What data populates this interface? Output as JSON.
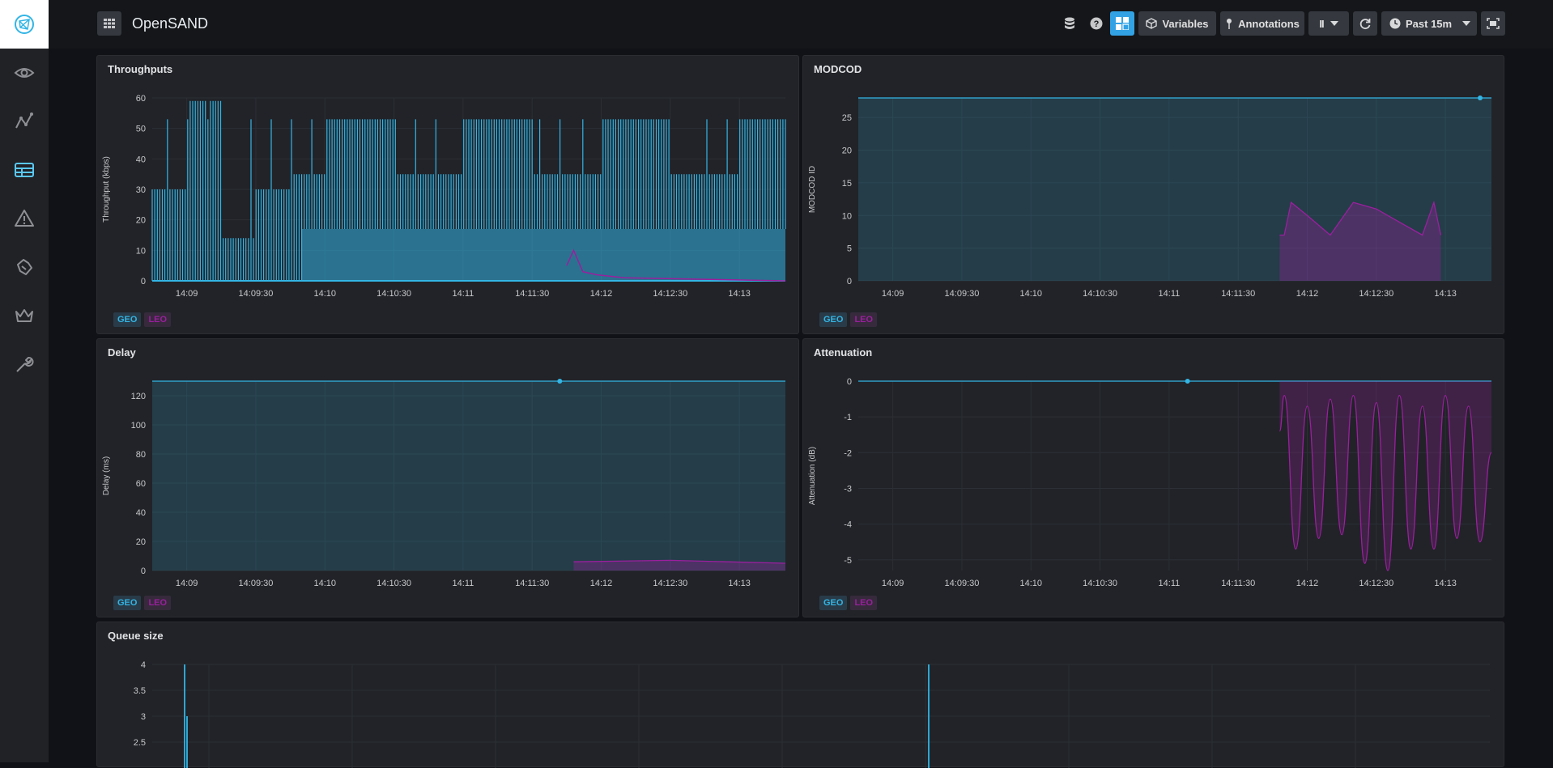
{
  "app": {
    "title": "OpenSAND"
  },
  "toolbar": {
    "variables_label": "Variables",
    "annotations_label": "Annotations",
    "pause_label": "II",
    "time_range_label": "Past 15m",
    "icons": [
      "database-icon",
      "help-icon",
      "dashboard-add-icon",
      "cube-icon",
      "pin-icon",
      "pause-icon",
      "refresh-icon",
      "clock-icon",
      "kiosk-icon"
    ]
  },
  "sidebar": {
    "items": [
      {
        "icon": "eye-icon",
        "active": false
      },
      {
        "icon": "explore-icon",
        "active": false
      },
      {
        "icon": "dashboards-icon",
        "active": true
      },
      {
        "icon": "alert-icon",
        "active": false
      },
      {
        "icon": "plugins-icon",
        "active": false
      },
      {
        "icon": "crown-icon",
        "active": false
      },
      {
        "icon": "wrench-icon",
        "active": false
      }
    ]
  },
  "colors": {
    "geo": "#33b5e5",
    "leo": "#9b1f9e",
    "background": "#111217",
    "panel": "#212328"
  },
  "panels": [
    {
      "title": "Throughputs",
      "legend": [
        "GEO",
        "LEO"
      ]
    },
    {
      "title": "MODCOD",
      "legend": [
        "GEO",
        "LEO"
      ]
    },
    {
      "title": "Delay",
      "legend": [
        "GEO",
        "LEO"
      ]
    },
    {
      "title": "Attenuation",
      "legend": [
        "GEO",
        "LEO"
      ]
    },
    {
      "title": "Queue size"
    }
  ],
  "chart_data": [
    {
      "type": "line",
      "title": "Throughputs",
      "ylabel": "Throughput (kbps)",
      "ylim": [
        0,
        60
      ],
      "yticks": [
        "60",
        "50",
        "40",
        "30",
        "20",
        "10",
        "0"
      ],
      "xticks": [
        "14:09",
        "14:09:30",
        "14:10",
        "14:10:30",
        "14:11",
        "14:11:30",
        "14:12",
        "14:12:30",
        "14:13"
      ],
      "series": [
        {
          "name": "GEO",
          "x": [
            "14:08:45",
            "14:09:00",
            "14:09:15",
            "14:09:30",
            "14:09:45",
            "14:10:00",
            "14:10:30",
            "14:11:00",
            "14:11:30",
            "14:12:00",
            "14:12:30",
            "14:13:00",
            "14:13:20"
          ],
          "y": [
            30,
            59,
            14,
            30,
            35,
            53,
            35,
            53,
            35,
            53,
            35,
            53,
            35
          ]
        },
        {
          "name": "LEO",
          "x": [
            "14:11:45",
            "14:11:48",
            "14:11:52",
            "14:11:58",
            "14:12:10",
            "14:13:20"
          ],
          "y": [
            5,
            10,
            3,
            2,
            1,
            0
          ]
        }
      ]
    },
    {
      "type": "area",
      "title": "MODCOD",
      "ylabel": "MODCOD ID",
      "ylim": [
        0,
        28
      ],
      "yticks": [
        "25",
        "20",
        "15",
        "10",
        "5",
        "0"
      ],
      "xticks": [
        "14:09",
        "14:09:30",
        "14:10",
        "14:10:30",
        "14:11",
        "14:11:30",
        "14:12",
        "14:12:30",
        "14:13"
      ],
      "series": [
        {
          "name": "GEO",
          "x": [
            "14:08:45",
            "14:13:20"
          ],
          "y": [
            28,
            28
          ]
        },
        {
          "name": "LEO",
          "x": [
            "14:11:48",
            "14:11:50",
            "14:11:53",
            "14:12:00",
            "14:12:10",
            "14:12:20",
            "14:12:30",
            "14:12:40",
            "14:12:50",
            "14:12:55",
            "14:12:58"
          ],
          "y": [
            7,
            7,
            12,
            10,
            7,
            12,
            11,
            9,
            7,
            12,
            7
          ]
        }
      ]
    },
    {
      "type": "area",
      "title": "Delay",
      "ylabel": "Delay (ms)",
      "ylim": [
        0,
        130
      ],
      "yticks": [
        "120",
        "100",
        "80",
        "60",
        "40",
        "20",
        "0"
      ],
      "xticks": [
        "14:09",
        "14:09:30",
        "14:10",
        "14:10:30",
        "14:11",
        "14:11:30",
        "14:12",
        "14:12:30",
        "14:13"
      ],
      "series": [
        {
          "name": "GEO",
          "x": [
            "14:08:45",
            "14:13:20"
          ],
          "y": [
            130,
            130
          ]
        },
        {
          "name": "LEO",
          "x": [
            "14:11:48",
            "14:12:30",
            "14:13:20"
          ],
          "y": [
            6,
            7,
            5
          ]
        }
      ]
    },
    {
      "type": "line",
      "title": "Attenuation",
      "ylabel": "Attenuation (dB)",
      "ylim": [
        -5.3,
        0
      ],
      "yticks": [
        "0",
        "-1",
        "-2",
        "-3",
        "-4",
        "-5"
      ],
      "xticks": [
        "14:09",
        "14:09:30",
        "14:10",
        "14:10:30",
        "14:11",
        "14:11:30",
        "14:12",
        "14:12:30",
        "14:13"
      ],
      "series": [
        {
          "name": "GEO",
          "x": [
            "14:08:45",
            "14:13:20"
          ],
          "y": [
            0,
            0
          ]
        },
        {
          "name": "LEO",
          "x": [
            "14:11:48",
            "14:11:50",
            "14:11:55",
            "14:12:00",
            "14:12:05",
            "14:12:10",
            "14:12:15",
            "14:12:20",
            "14:12:25",
            "14:12:30",
            "14:12:35",
            "14:12:40",
            "14:12:45",
            "14:12:50",
            "14:12:55",
            "14:13:00",
            "14:13:05",
            "14:13:10",
            "14:13:15",
            "14:13:20"
          ],
          "y": [
            -1.4,
            -0.4,
            -4.7,
            -0.7,
            -4.4,
            -0.5,
            -4.3,
            -0.4,
            -5.1,
            -0.6,
            -5.3,
            -0.4,
            -4.7,
            -0.7,
            -4.7,
            -0.4,
            -4.4,
            -0.7,
            -4.5,
            -2.0
          ]
        }
      ]
    },
    {
      "type": "line",
      "title": "Queue size",
      "ylim": [
        2.5,
        4
      ],
      "yticks": [
        "4",
        "3.5",
        "3",
        "2.5"
      ],
      "series": [
        {
          "name": "GEO",
          "y": [
            4,
            3,
            4
          ]
        }
      ]
    }
  ]
}
